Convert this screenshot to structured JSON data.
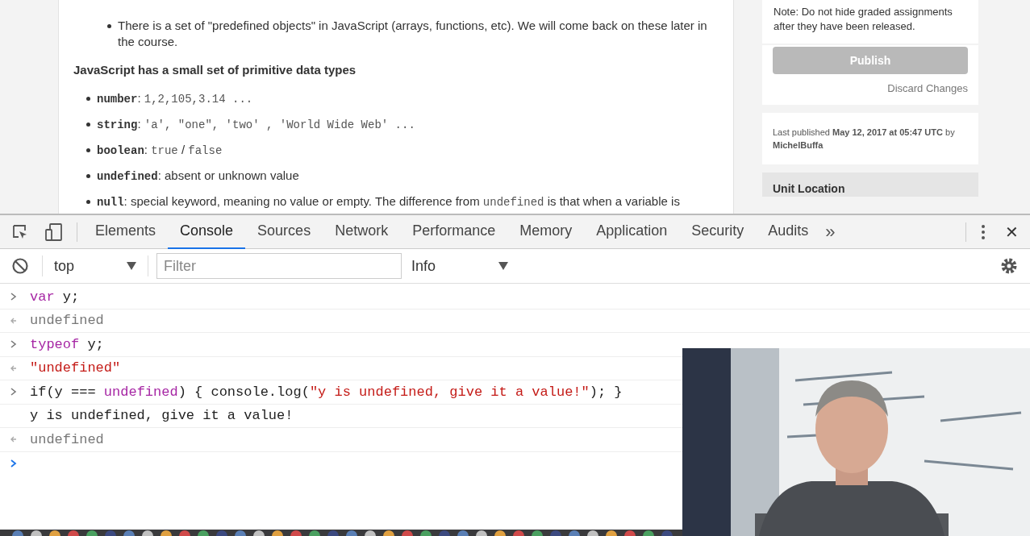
{
  "article": {
    "bullet": "There is a set of \"predefined objects\" in JavaScript (arrays, functions, etc). We will come back on these later in the course.",
    "heading": "JavaScript has a small set of primitive data types",
    "types": [
      {
        "parts": [
          {
            "kind": "term",
            "text": "number"
          },
          {
            "kind": "text",
            "text": ": "
          },
          {
            "kind": "code",
            "text": "1,2,105,3.14 ..."
          }
        ]
      },
      {
        "parts": [
          {
            "kind": "term",
            "text": "string"
          },
          {
            "kind": "text",
            "text": ": "
          },
          {
            "kind": "code",
            "text": "'a', \"one\", 'two' , 'World Wide Web' ..."
          }
        ]
      },
      {
        "parts": [
          {
            "kind": "term",
            "text": "boolean"
          },
          {
            "kind": "text",
            "text": ": "
          },
          {
            "kind": "code",
            "text": "true"
          },
          {
            "kind": "text",
            "text": " / "
          },
          {
            "kind": "code",
            "text": "false"
          }
        ]
      },
      {
        "parts": [
          {
            "kind": "term",
            "text": "undefined"
          },
          {
            "kind": "text",
            "text": ": absent or unknown value"
          }
        ]
      },
      {
        "parts": [
          {
            "kind": "term",
            "text": "null"
          },
          {
            "kind": "text",
            "text": ": special keyword, meaning no value or empty. The difference from "
          },
          {
            "kind": "code",
            "text": "undefined"
          },
          {
            "kind": "text",
            "text": " is that when a variable is"
          }
        ]
      }
    ]
  },
  "sidebar": {
    "note": "Note: Do not hide graded assignments after they have been released.",
    "publish": {
      "label": "Publish",
      "disabled": true
    },
    "discard": "Discard Changes",
    "last_published": "Last published **May 12, 2017 at 05:47 UTC** by **MichelBuffa**",
    "unit_location": "Unit Location"
  },
  "devtools": {
    "tabs": [
      {
        "label": "Elements",
        "selected": false
      },
      {
        "label": "Console",
        "selected": true
      },
      {
        "label": "Sources",
        "selected": false
      },
      {
        "label": "Network",
        "selected": false
      },
      {
        "label": "Performance",
        "selected": false
      },
      {
        "label": "Memory",
        "selected": false
      },
      {
        "label": "Application",
        "selected": false
      },
      {
        "label": "Security",
        "selected": false
      },
      {
        "label": "Audits",
        "selected": false
      }
    ],
    "more": "»",
    "close": "✕",
    "context": "top",
    "filter": {
      "placeholder": "Filter"
    },
    "level": "Info",
    "console": [
      {
        "kind": "input",
        "tokens": [
          {
            "kind": "keyword",
            "text": "var"
          },
          {
            "kind": "plain",
            "text": " y;"
          }
        ]
      },
      {
        "kind": "result",
        "tokens": [
          {
            "kind": "muted",
            "text": "undefined"
          }
        ]
      },
      {
        "kind": "input",
        "tokens": [
          {
            "kind": "keyword",
            "text": "typeof"
          },
          {
            "kind": "plain",
            "text": " y;"
          }
        ]
      },
      {
        "kind": "result",
        "tokens": [
          {
            "kind": "string",
            "text": "\"undefined\""
          }
        ]
      },
      {
        "kind": "input",
        "tokens": [
          {
            "kind": "plain",
            "text": "if(y === "
          },
          {
            "kind": "keyword",
            "text": "undefined"
          },
          {
            "kind": "plain",
            "text": ") { console.log("
          },
          {
            "kind": "string",
            "text": "\"y is undefined, give it a value!\""
          },
          {
            "kind": "plain",
            "text": "); }"
          }
        ]
      },
      {
        "kind": "log",
        "tokens": [
          {
            "kind": "plain",
            "text": "y is undefined, give it a value!"
          }
        ]
      },
      {
        "kind": "result",
        "tokens": [
          {
            "kind": "muted",
            "text": "undefined"
          }
        ]
      },
      {
        "kind": "prompt"
      }
    ]
  }
}
